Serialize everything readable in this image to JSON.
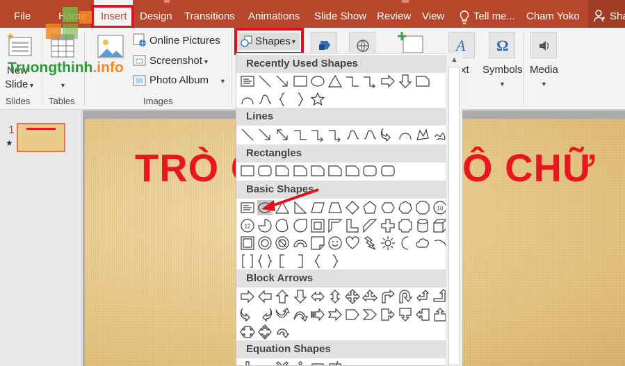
{
  "menu": {
    "tabs": [
      "File",
      "Home",
      "Insert",
      "Design",
      "Transitions",
      "Animations",
      "Slide Show",
      "Review",
      "View"
    ],
    "active_tab": "Insert",
    "tell_me": "Tell me...",
    "user": "Cham Yoko",
    "share": "Sha"
  },
  "ribbon": {
    "slides": {
      "new_slide_line1": "New",
      "new_slide_line2": "Slide",
      "group_label": "Slides"
    },
    "tables": {
      "group_label": "Tables"
    },
    "images": {
      "online_pictures": "Online Pictures",
      "screenshot": "Screenshot",
      "photo_album": "Photo Album",
      "group_label": "Images"
    },
    "shapes_button": "Shapes",
    "text_partial": "xt",
    "symbols": "Symbols",
    "media": "Media"
  },
  "watermark": {
    "part1": "Truongthinh",
    "part2": ".info"
  },
  "thumbnails": {
    "slide_number": "1",
    "star": "★"
  },
  "slide": {
    "title_left": "TRÒ C",
    "title_right": "Ô CHỮ"
  },
  "shapes_menu": {
    "sections": [
      "Recently Used Shapes",
      "Lines",
      "Rectangles",
      "Basic Shapes",
      "Block Arrows",
      "Equation Shapes"
    ]
  },
  "colors": {
    "accent": "#b7472a",
    "highlight": "#e0101d",
    "title_red": "#e8171e"
  }
}
